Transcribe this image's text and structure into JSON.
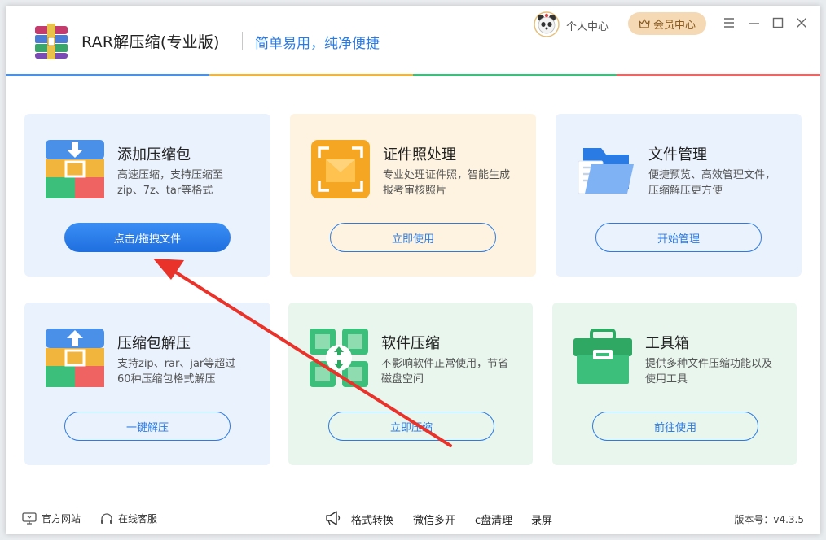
{
  "header": {
    "app_title": "RAR解压缩(专业版)",
    "slogan": "简单易用，纯净便捷",
    "user_center": "个人中心",
    "vip_center": "会员中心"
  },
  "colors": {
    "accent_blue": "#2b7be5",
    "bar_blue": "#4a90e8",
    "bar_yellow": "#f1b43c",
    "bar_green": "#3cbf7a",
    "bar_red": "#ef6363",
    "annotation_red": "#e8322a"
  },
  "cards": [
    {
      "title": "添加压缩包",
      "desc": "高速压缩，支持压缩至zip、7z、tar等格式",
      "button": "点击/拖拽文件",
      "icon": "compress-box-icon"
    },
    {
      "title": "证件照处理",
      "desc": "专业处理证件照，智能生成报考审核照片",
      "button": "立即使用",
      "icon": "id-photo-icon"
    },
    {
      "title": "文件管理",
      "desc": "便捷预览、高效管理文件，压缩解压更方便",
      "button": "开始管理",
      "icon": "folder-icon"
    },
    {
      "title": "压缩包解压",
      "desc": "支持zip、rar、jar等超过60种压缩包格式解压",
      "button": "一键解压",
      "icon": "extract-box-icon"
    },
    {
      "title": "软件压缩",
      "desc": "不影响软件正常使用，节省磁盘空间",
      "button": "立即压缩",
      "icon": "software-compress-icon"
    },
    {
      "title": "工具箱",
      "desc": "提供多种文件压缩功能以及使用工具",
      "button": "前往使用",
      "icon": "toolbox-icon"
    }
  ],
  "footer": {
    "website": "官方网站",
    "service": "在线客服",
    "links": [
      "格式转换",
      "微信多开",
      "c盘清理",
      "录屏"
    ],
    "version": "版本号：v4.3.5"
  }
}
